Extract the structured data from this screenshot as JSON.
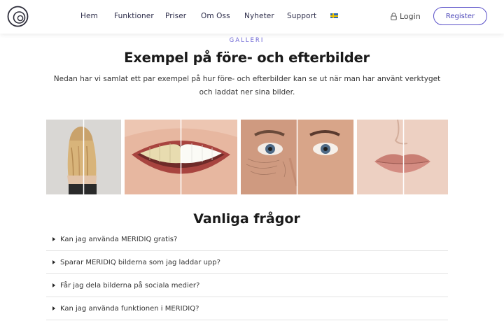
{
  "header": {
    "logo": "meridiq-logo",
    "nav": [
      {
        "label": "Hem"
      },
      {
        "label": "Funktioner"
      },
      {
        "label": "Priser"
      },
      {
        "label": "Om Oss"
      },
      {
        "label": "Nyheter"
      },
      {
        "label": "Support"
      }
    ],
    "language_icon": "swedish-flag-icon",
    "login_icon": "lock-icon",
    "login_label": "Login",
    "register_label": "Register"
  },
  "gallery": {
    "eyebrow": "GALLERI",
    "title": "Exempel på före- och efterbilder",
    "description": "Nedan har vi samlat ett par exempel på hur före- och efterbilder kan se ut när man har använt verktyget och laddat ner sina bilder.",
    "images": [
      {
        "subject": "hair"
      },
      {
        "subject": "teeth"
      },
      {
        "subject": "eyes"
      },
      {
        "subject": "lips"
      }
    ]
  },
  "faq": {
    "title": "Vanliga frågor",
    "items": [
      {
        "question": "Kan jag använda MERIDIQ gratis?"
      },
      {
        "question": "Sparar MERIDIQ bilderna som jag laddar upp?"
      },
      {
        "question": "Får jag dela bilderna på sociala medier?"
      },
      {
        "question": "Kan jag använda funktionen i MERIDIQ?"
      }
    ]
  },
  "colors": {
    "accent": "#5b52c9",
    "eyebrow": "#6b64d4",
    "text": "#222222"
  }
}
